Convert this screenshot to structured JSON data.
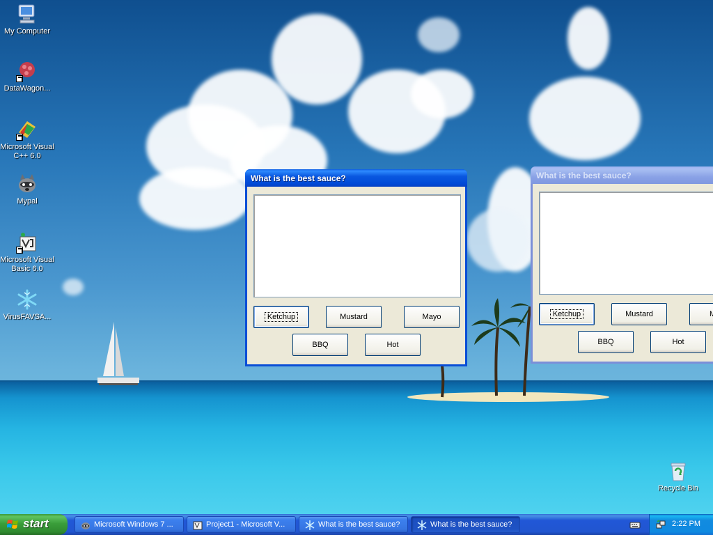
{
  "desktop": {
    "icons": [
      {
        "label": "My Computer"
      },
      {
        "label": "DataWagon..."
      },
      {
        "label": "Microsoft Visual C++ 6.0"
      },
      {
        "label": "Mypal"
      },
      {
        "label": "Microsoft Visual Basic 6.0"
      },
      {
        "label": "VirusFAVSA..."
      },
      {
        "label": "Recycle Bin"
      }
    ]
  },
  "window_active": {
    "title": "What is the best sauce?",
    "textbox_value": "",
    "buttons": [
      "Ketchup",
      "Mustard",
      "Mayo",
      "BBQ",
      "Hot"
    ],
    "focused_button": "Ketchup"
  },
  "window_inactive": {
    "title": "What is the best sauce?",
    "textbox_value": "",
    "buttons": [
      "Ketchup",
      "Mustard",
      "M",
      "BBQ",
      "Hot"
    ]
  },
  "taskbar": {
    "start_label": "start",
    "tasks": [
      {
        "label": "Microsoft Windows 7 ...",
        "icon": "raccoon-icon"
      },
      {
        "label": "Project1 - Microsoft V...",
        "icon": "vb-icon"
      },
      {
        "label": "What is the best sauce?",
        "icon": "snowflake-icon"
      },
      {
        "label": "What is the best sauce?",
        "icon": "snowflake-icon"
      }
    ],
    "active_task_index": 3,
    "clock": "2:22 PM"
  },
  "colors": {
    "titlebar_active": "#0a58e0",
    "titlebar_inactive": "#8aa2e6",
    "taskbar": "#2156d0",
    "start_button": "#3a9e3a",
    "window_face": "#ece9d8"
  }
}
